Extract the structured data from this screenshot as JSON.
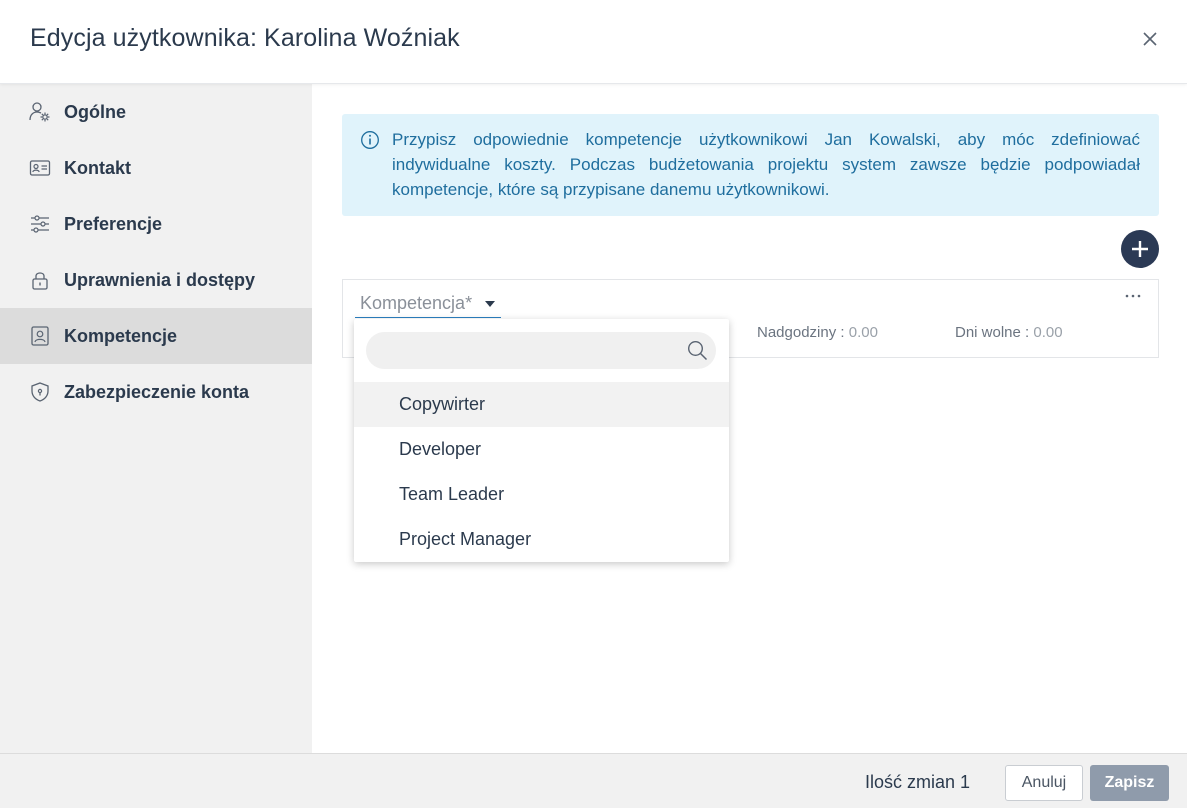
{
  "dialog": {
    "title": "Edycja użytkownika: Karolina Woźniak",
    "close_icon": "close-icon"
  },
  "sidebar": {
    "items": [
      {
        "label": "Ogólne",
        "icon": "user-gear-icon"
      },
      {
        "label": "Kontakt",
        "icon": "id-card-icon"
      },
      {
        "label": "Preferencje",
        "icon": "sliders-icon"
      },
      {
        "label": "Uprawnienia i dostępy",
        "icon": "lock-icon"
      },
      {
        "label": "Kompetencje",
        "icon": "user-badge-icon",
        "active": true
      },
      {
        "label": "Zabezpieczenie konta",
        "icon": "shield-icon"
      }
    ]
  },
  "info": {
    "icon": "info-icon",
    "text": "Przypisz odpowiednie kompetencje użytkownikowi Jan Kowalski, aby móc zdefiniować indywidualne koszty. Podczas budżetowania projektu system zawsze będzie podpowiadał kompetencje, które są przypisane danemu użytkownikowi."
  },
  "competence_row": {
    "select_placeholder": "Kompetencja*",
    "overtime_label": "Nadgodziny",
    "overtime_value": "0.00",
    "days_off_label": "Dni wolne",
    "days_off_value": "0.00"
  },
  "dropdown": {
    "search_placeholder": "",
    "options": [
      "Copywirter",
      "Developer",
      "Team Leader",
      "Project Manager"
    ],
    "highlighted_index": 0
  },
  "footer": {
    "changes_label": "Ilość zmian 1",
    "cancel_label": "Anuluj",
    "save_label": "Zapisz"
  },
  "colors": {
    "accent_dark": "#2b3a55",
    "info_bg": "#e0f3fb",
    "info_text": "#1f6e9e",
    "save_disabled": "#8f9bab",
    "sidebar_bg": "#f1f1f1",
    "sidebar_active": "#dcdcdc"
  }
}
